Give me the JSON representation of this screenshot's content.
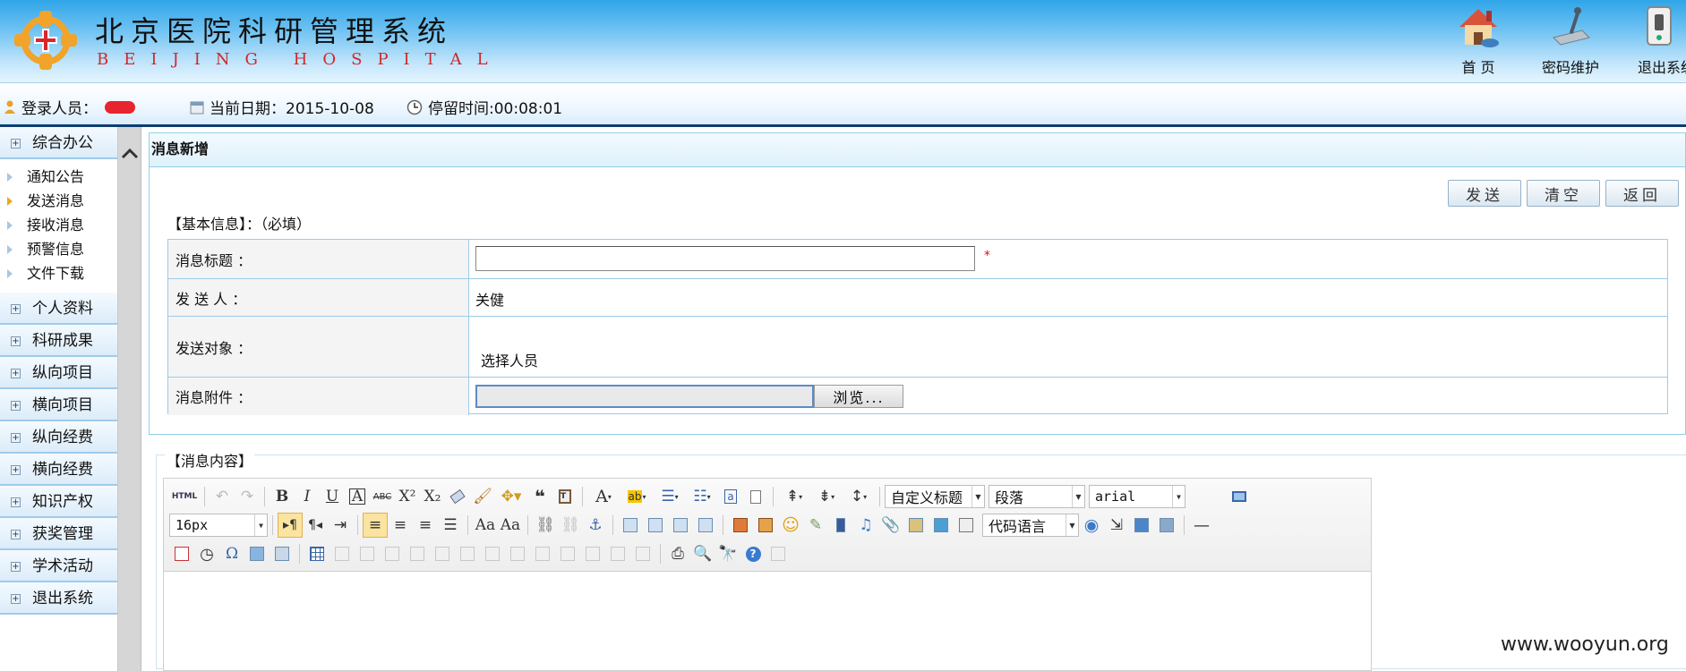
{
  "header": {
    "title_cn": "北京医院科研管理系统",
    "title_en": "BEIJING HOSPITAL",
    "nav": [
      {
        "label": "首 页",
        "icon": "house-icon"
      },
      {
        "label": "密码维护",
        "icon": "key-icon"
      },
      {
        "label": "退出系统",
        "icon": "power-switch-icon"
      }
    ]
  },
  "infobar": {
    "login_label": "登录人员：",
    "date_text": "当前日期：2015-10-08",
    "stay_text": "停留时间:00:08:01"
  },
  "sidebar": {
    "groups": [
      {
        "label": "综合办公"
      },
      {
        "label": "个人资料"
      },
      {
        "label": "科研成果"
      },
      {
        "label": "纵向项目"
      },
      {
        "label": "横向项目"
      },
      {
        "label": "纵向经费"
      },
      {
        "label": "横向经费"
      },
      {
        "label": "知识产权"
      },
      {
        "label": "获奖管理"
      },
      {
        "label": "学术活动"
      },
      {
        "label": "退出系统"
      }
    ],
    "items": [
      {
        "label": "通知公告"
      },
      {
        "label": "发送消息",
        "active": true
      },
      {
        "label": "接收消息"
      },
      {
        "label": "预警信息"
      },
      {
        "label": "文件下载"
      }
    ]
  },
  "panel": {
    "title": "消息新增",
    "buttons": {
      "send": "发送",
      "clear": "清空",
      "back": "返回"
    },
    "basic_legend": "【基本信息】：（必填）",
    "fields": {
      "title_label": "消息标题 ：",
      "title_value": "",
      "required_mark": "*",
      "sender_label": "发 送 人 ：",
      "sender_value": "关健",
      "target_label": "发送对象 ：",
      "target_link": "选择人员",
      "attach_label": "消息附件 ：",
      "browse_label": "浏览..."
    },
    "content_legend": "【消息内容】"
  },
  "editor": {
    "html_label": "HTML",
    "heading_select": "自定义标题",
    "paragraph_select": "段落",
    "font_select": "arial",
    "size_select": "16px",
    "code_select": "代码语言"
  },
  "watermark": "www.wooyun.org",
  "colors": {
    "header_blue": "#2fa5e8",
    "infobar_border": "#0f3d70",
    "required": "#dd1111",
    "active_arrow": "#f0a61e"
  }
}
